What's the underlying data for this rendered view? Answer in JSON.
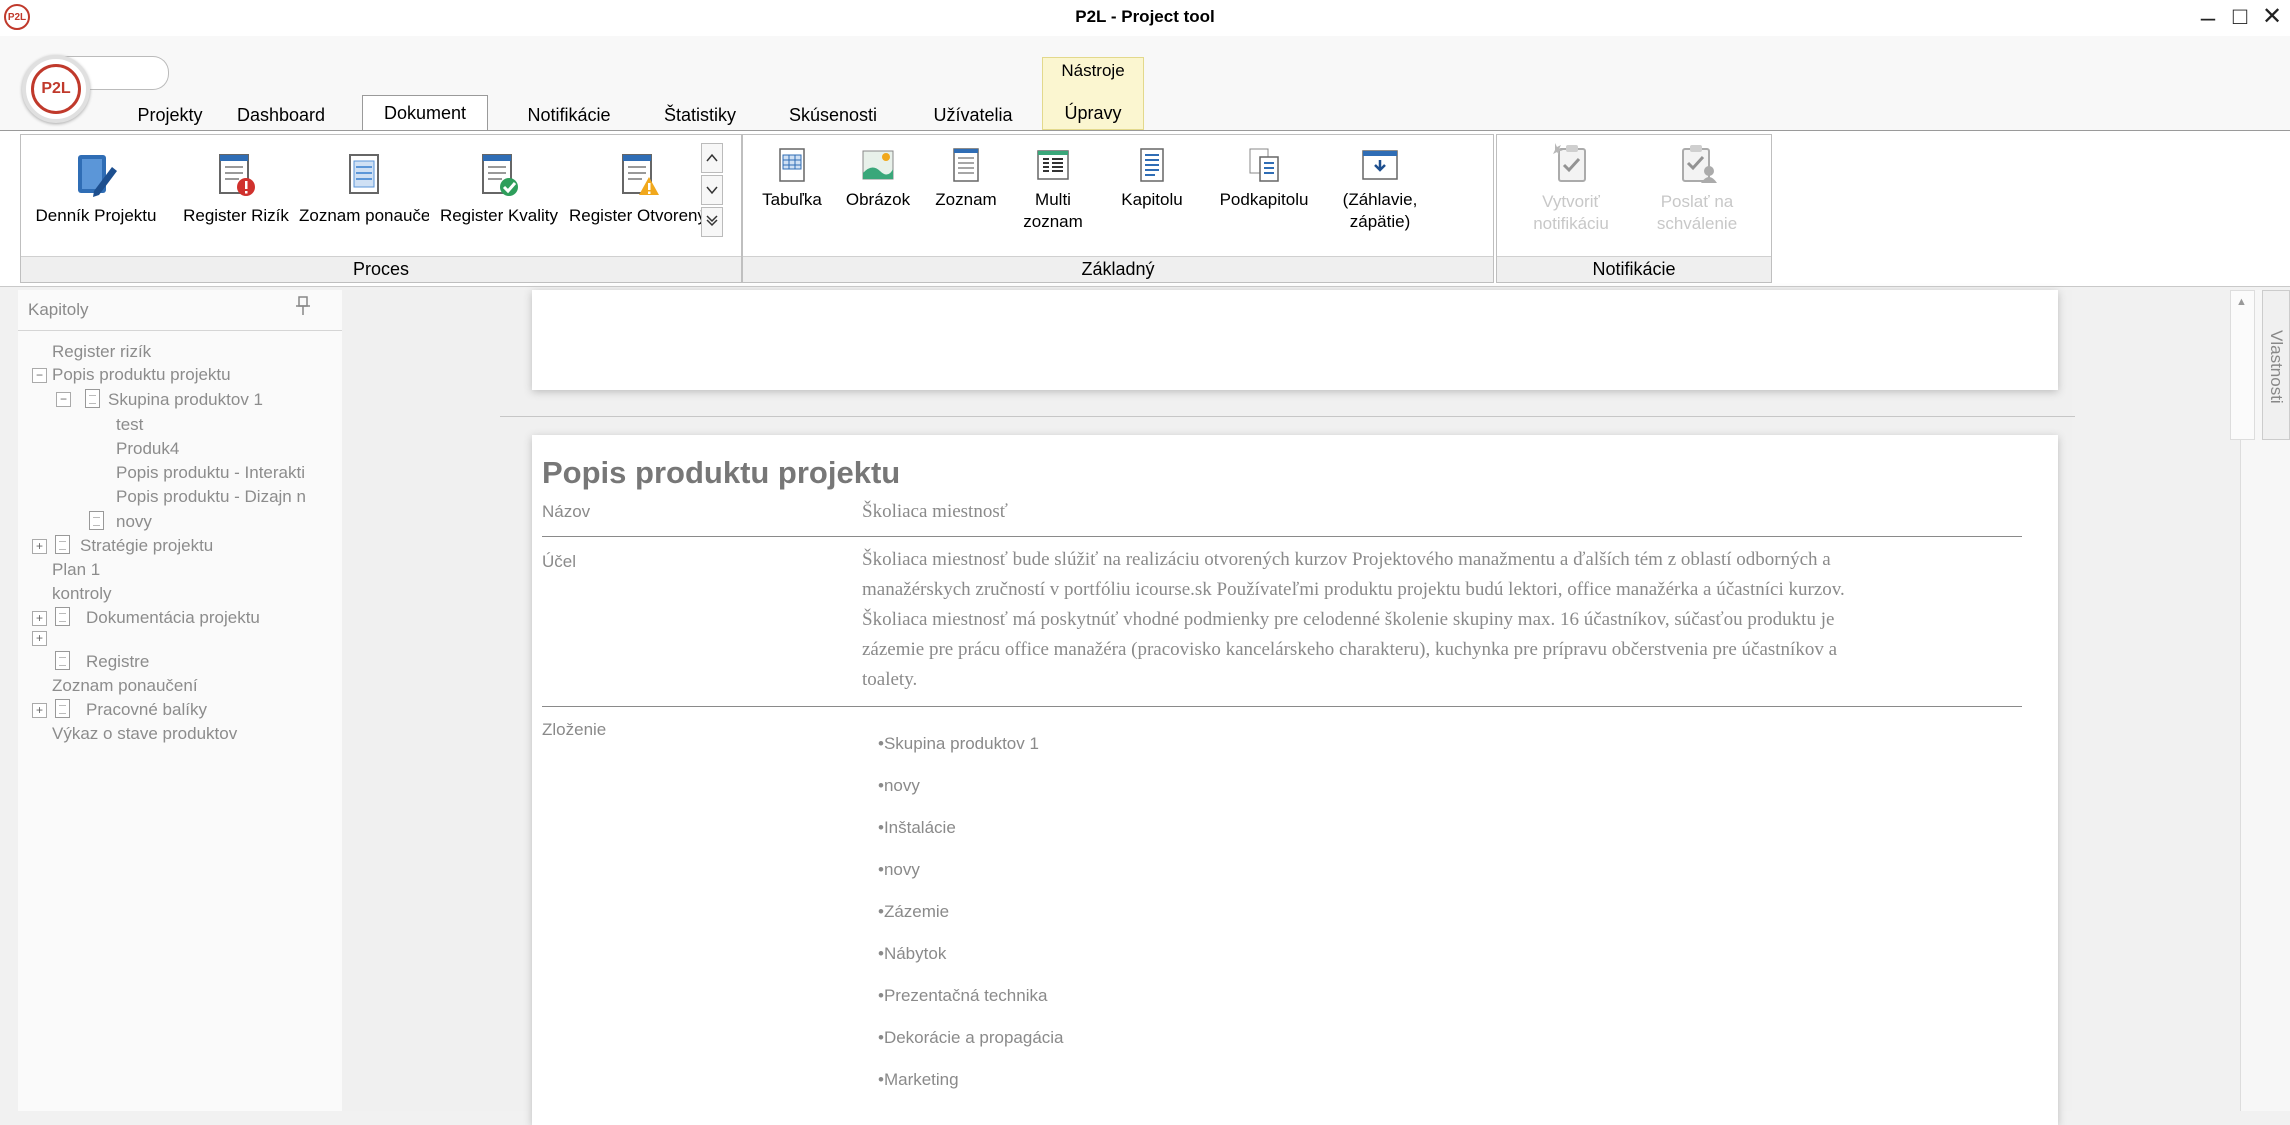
{
  "window": {
    "title": "P2L - Project tool",
    "app_badge": "P2L",
    "minimize": "–",
    "maximize": "□",
    "close": "✕"
  },
  "logo": {
    "text": "P2L"
  },
  "tabs": [
    "Projekty",
    "Dashboard",
    "Dokument",
    "Notifikácie",
    "Štatistiky",
    "Skúsenosti",
    "Užívatelia"
  ],
  "active_tab": "Dokument",
  "context_tab": {
    "group": "Nástroje",
    "label": "Úpravy"
  },
  "ribbon": {
    "proces": {
      "label": "Proces",
      "buttons": [
        "Denník Projektu",
        "Register Rizík",
        "Zoznam ponaučení",
        "Register Kvality",
        "Register Otvorených"
      ]
    },
    "zakladny": {
      "label": "Základný",
      "buttons": [
        {
          "line1": "Tabuľka",
          "line2": ""
        },
        {
          "line1": "Obrázok",
          "line2": ""
        },
        {
          "line1": "Zoznam",
          "line2": ""
        },
        {
          "line1": "Multi",
          "line2": "zoznam"
        },
        {
          "line1": "Kapitolu",
          "line2": ""
        },
        {
          "line1": "Podkapitolu",
          "line2": ""
        },
        {
          "line1": "(Záhlavie,",
          "line2": "zápätie)"
        }
      ]
    },
    "notifikacie": {
      "label": "Notifikácie",
      "buttons": [
        {
          "line1": "Vytvoriť",
          "line2": "notifikáciu"
        },
        {
          "line1": "Poslať na",
          "line2": "schválenie"
        }
      ]
    }
  },
  "panel": {
    "title": "Kapitoly",
    "tree": [
      "Register rizík",
      "Popis produktu projektu",
      "Skupina produktov 1",
      "test",
      "Produk4",
      "Popis produktu - Interakti",
      "Popis produktu - Dizajn n",
      "novy",
      "Stratégie projektu",
      "Plan 1",
      "kontroly",
      "Dokumentácia projektu",
      "Registre",
      "Zoznam ponaučení",
      "Pracovné balíky",
      "Výkaz o stave produktov"
    ]
  },
  "document": {
    "heading": "Popis produktu projektu",
    "rows": {
      "nazov": {
        "label": "Názov",
        "value": "Školiaca miestnosť"
      },
      "ucel": {
        "label": "Účel",
        "lines": [
          "Školiaca miestnosť bude slúžiť na realizáciu otvorených kurzov Projektového manažmentu a ďalších tém z oblastí odborných a",
          "manažérskych zručností v portfóliu icourse.sk Používateľmi produktu projektu budú lektori, office manažérka a účastníci kurzov.",
          "Školiaca miestnosť má poskytnúť vhodné podmienky pre celodenné školenie skupiny max. 16 účastníkov, súčasťou produktu je",
          "zázemie pre prácu office manažéra (pracovisko kancelárskeho charakteru), kuchynka pre prípravu občerstvenia pre účastníkov a",
          "toalety."
        ]
      },
      "zlozenie": {
        "label": "Zloženie",
        "items": [
          "•Skupina produktov 1",
          "•novy",
          "•Inštalácie",
          "•novy",
          "•Zázemie",
          "•Nábytok",
          "•Prezentačná technika",
          "•Dekorácie a propagácia",
          "•Marketing"
        ]
      }
    }
  },
  "side": {
    "properties_label": "Vlastnosti",
    "scroll_up": "▲"
  }
}
